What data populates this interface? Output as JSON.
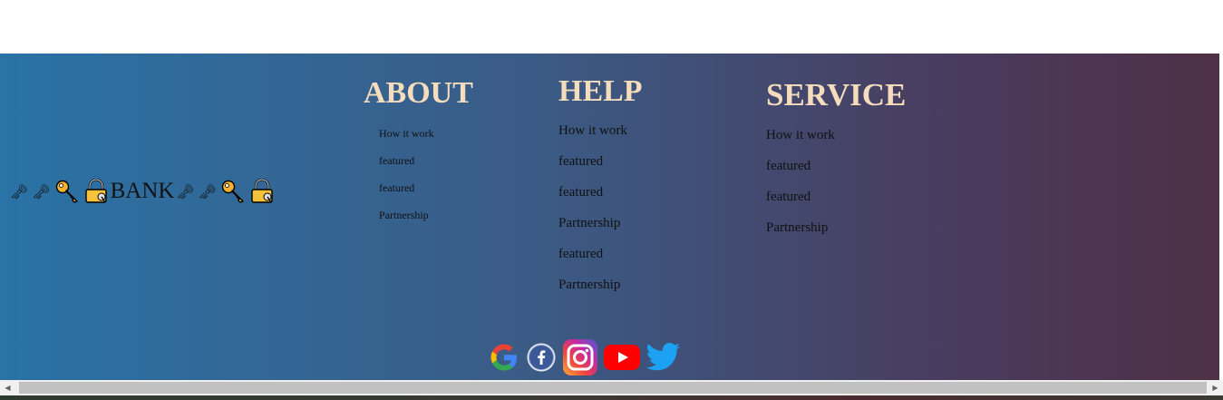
{
  "logo": {
    "prefix_glyphs": "🗝🗝",
    "word": "BANK",
    "suffix_glyphs": "🗝🗝"
  },
  "columns": {
    "about": {
      "title": "ABOUT",
      "links": [
        "How it work",
        "featured",
        "featured",
        "Partnership"
      ]
    },
    "help": {
      "title": "HELP",
      "links": [
        "How it work",
        "featured",
        "featured",
        "Partnership",
        "featured",
        "Partnership"
      ]
    },
    "service": {
      "title": "SERVICE",
      "links": [
        "How it work",
        "featured",
        "featured",
        "Partnership"
      ]
    }
  },
  "social": [
    "google-icon",
    "facebook-icon",
    "instagram-icon",
    "youtube-icon",
    "twitter-icon"
  ],
  "scrollbar": {
    "left_arrow": "◀",
    "right_arrow": "▶"
  },
  "colors": {
    "heading": "#f5dcbc",
    "gradient_start": "#2a73a6",
    "gradient_end": "#4e3146"
  }
}
